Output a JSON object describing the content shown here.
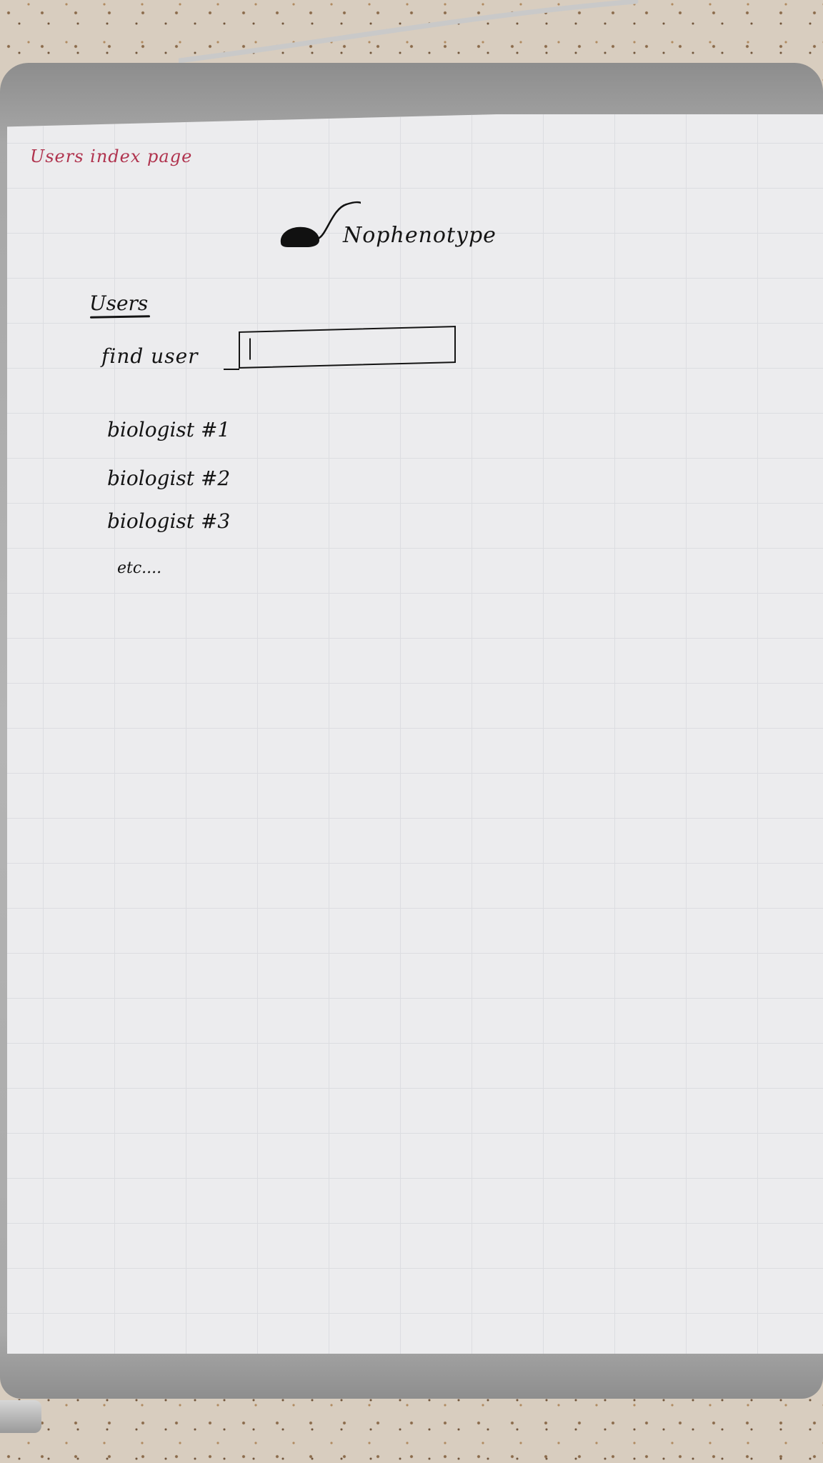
{
  "page_caption": "Users index page",
  "logo": {
    "text": "Nophenotype",
    "icon": "mouse-icon"
  },
  "section": {
    "title": "Users"
  },
  "search": {
    "label": "find user",
    "value": "",
    "caret_icon": "text-caret-icon"
  },
  "users": [
    {
      "label": "biologist #1"
    },
    {
      "label": "biologist #2"
    },
    {
      "label": "biologist #3"
    },
    {
      "label": "etc...."
    }
  ],
  "colors": {
    "ink": "#141414",
    "caption_ink": "#b0334e",
    "paper": "#ececee"
  }
}
